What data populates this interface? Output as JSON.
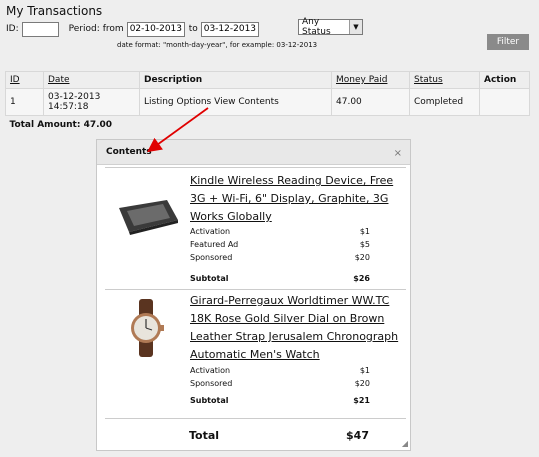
{
  "header": {
    "title": "My Transactions"
  },
  "filters": {
    "id_label": "ID:",
    "id_value": "",
    "period_label": "Period:",
    "from_label": "from",
    "from_value": "02-10-2013",
    "to_label": "to",
    "to_value": "03-12-2013",
    "status_value": "Any Status",
    "hint": "date format: \"month-day-year\", for example: 03-12-2013",
    "button_label": "Filter"
  },
  "table": {
    "headers": [
      "ID",
      "Date",
      "Description",
      "Money Paid",
      "Status",
      "Action"
    ],
    "row": {
      "id": "1",
      "date": "03-12-2013 14:57:18",
      "description": "Listing Options",
      "link": "View Contents",
      "money": "47.00",
      "status": "Completed",
      "action": ""
    },
    "total": "Total Amount: 47.00"
  },
  "popup": {
    "title": "Contents",
    "close": "×",
    "products": [
      {
        "title": "Kindle Wireless Reading Device, Free 3G + Wi-Fi, 6\" Display, Graphite, 3G Works Globally",
        "features": [
          {
            "name": "Activation",
            "price": "$1"
          },
          {
            "name": "Featured Ad",
            "price": "$5"
          },
          {
            "name": "Sponsored",
            "price": "$20"
          }
        ],
        "subtotal_label": "Subtotal",
        "subtotal": "$26"
      },
      {
        "title": "Girard-Perregaux Worldtimer WW.TC 18K Rose Gold Silver Dial on Brown Leather Strap Jerusalem Chronograph Automatic Men's Watch",
        "features": [
          {
            "name": "Activation",
            "price": "$1"
          },
          {
            "name": "Sponsored",
            "price": "$20"
          }
        ],
        "subtotal_label": "Subtotal",
        "subtotal": "$21"
      }
    ],
    "total_label": "Total",
    "total": "$47"
  },
  "colors": {
    "arrow": "#e00000",
    "button": "#8a8a8a",
    "background": "#eeeeee"
  }
}
